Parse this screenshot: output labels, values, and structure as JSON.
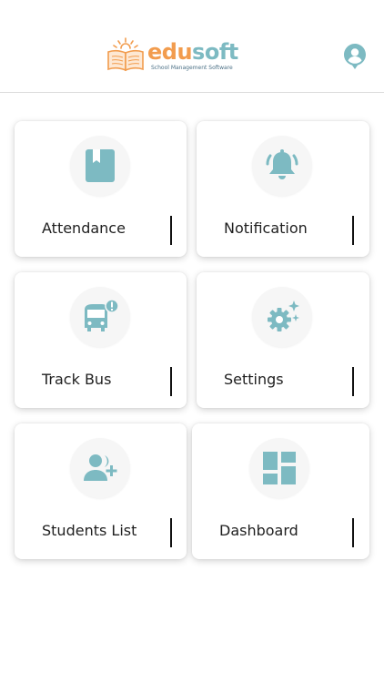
{
  "brand": {
    "name_part1": "edu",
    "name_part2": "soft",
    "tagline": "School Management Software"
  },
  "header": {
    "profile_icon": "account-circle-icon"
  },
  "colors": {
    "accent": "#7dbac2",
    "brand_orange": "#f29c4e",
    "card_bg": "#ffffff",
    "icon_circle_bg": "#f6f6f6"
  },
  "menu": [
    {
      "label": "Attendance",
      "icon": "book-icon"
    },
    {
      "label": "Notification",
      "icon": "bell-icon"
    },
    {
      "label": "Track Bus",
      "icon": "bus-alert-icon"
    },
    {
      "label": "Settings",
      "icon": "settings-gear-icon"
    },
    {
      "label": "Students List",
      "icon": "add-user-icon"
    },
    {
      "label": "Dashboard",
      "icon": "dashboard-icon"
    }
  ]
}
